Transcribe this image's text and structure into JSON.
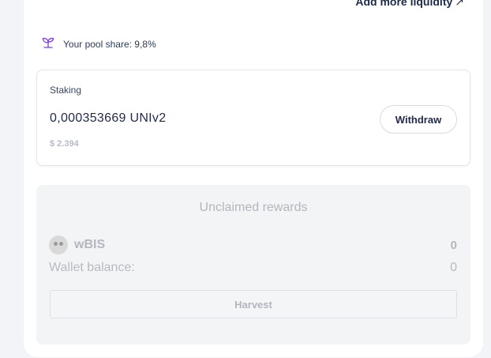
{
  "header": {
    "add_liquidity_label": "Add more liquidity",
    "add_liquidity_arrow": "↗"
  },
  "pool": {
    "share_text": "Your pool share: 9,8%",
    "icon": "sprout-icon"
  },
  "staking": {
    "title": "Staking",
    "amount": "0,000353669 UNIv2",
    "usd_value": "$ 2.394",
    "withdraw_label": "Withdraw"
  },
  "rewards": {
    "title": "Unclaimed rewards",
    "token_name": "wBIS",
    "token_icon": "token-avatar-icon",
    "token_amount": "0",
    "wallet_label": "Wallet balance:",
    "wallet_value": "0",
    "harvest_label": "Harvest"
  },
  "colors": {
    "accent": "#7b3fe4",
    "text": "#1e2a4a",
    "muted": "#b3b6bd",
    "panel_bg": "#ffffff",
    "page_bg": "#f3f4f7"
  }
}
